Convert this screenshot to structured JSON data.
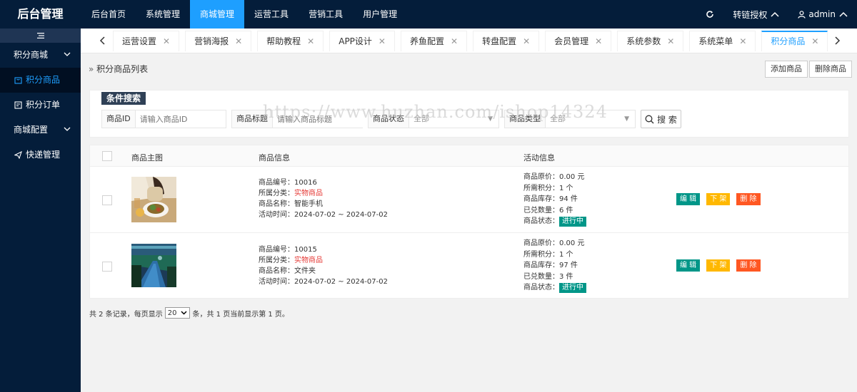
{
  "brand": "后台管理",
  "topnav": [
    "后台首页",
    "系统管理",
    "商城管理",
    "运营工具",
    "营销工具",
    "用户管理"
  ],
  "topright": {
    "auth_label": "转链授权",
    "user": "admin"
  },
  "sidebar": {
    "toggle_icon": "menu-toggle-icon",
    "groups": [
      {
        "label": "积分商城"
      },
      {
        "label": "积分商品"
      },
      {
        "label": "积分订单"
      },
      {
        "label": "商城配置"
      },
      {
        "label": "快递管理"
      }
    ]
  },
  "tabs": [
    "运营设置",
    "营销海报",
    "帮助教程",
    "APP设计",
    "养鱼配置",
    "转盘配置",
    "会员管理",
    "系统参数",
    "系统菜单",
    "积分商品"
  ],
  "active_tab": "积分商品",
  "breadcrumb": "积分商品列表",
  "toolbar": {
    "add": "添加商品",
    "delete": "删除商品"
  },
  "search": {
    "title": "条件搜索",
    "id_label": "商品ID",
    "id_placeholder": "请输入商品ID",
    "title_label": "商品标题",
    "title_placeholder": "请输入商品标题",
    "status_label": "商品状态",
    "status_value": "全部",
    "type_label": "商品类型",
    "type_value": "全部",
    "button": "搜 索"
  },
  "table": {
    "headers": [
      "商品主图",
      "商品信息",
      "活动信息"
    ],
    "rows": [
      {
        "no_label": "商品编号：",
        "no": "10016",
        "cat_label": "所属分类：",
        "cat": "实物商品",
        "name_label": "商品名称：",
        "name": "智能手机",
        "time_label": "活动时间：",
        "time": "2024-07-02 ~ 2024-07-02",
        "price": "商品原价：0.00 元",
        "points": "所需积分：1 个",
        "stock": "商品库存：94 件",
        "redeemed": "已兑数量：6 件",
        "status_label": "商品状态：",
        "status": "进行中"
      },
      {
        "no_label": "商品编号：",
        "no": "10015",
        "cat_label": "所属分类：",
        "cat": "实物商品",
        "name_label": "商品名称：",
        "name": "文件夹",
        "time_label": "活动时间：",
        "time": "2024-07-02 ~ 2024-07-02",
        "price": "商品原价：0.00 元",
        "points": "所需积分：1 个",
        "stock": "商品库存：97 件",
        "redeemed": "已兑数量：3 件",
        "status_label": "商品状态：",
        "status": "进行中"
      }
    ],
    "ops": {
      "edit": "编 辑",
      "off": "下 架",
      "del": "删 除"
    }
  },
  "pager": {
    "pre": "共 2 条记录，每页显示",
    "size": "20",
    "post": "条，共 1 页当前显示第 1 页。"
  },
  "watermark": "https://www.huzhan.com/ishop14324",
  "colors": {
    "nav_bg": "#041d3a",
    "accent": "#1e9fff",
    "teal": "#009688",
    "yellow": "#ffb800",
    "orange": "#ff5722"
  }
}
